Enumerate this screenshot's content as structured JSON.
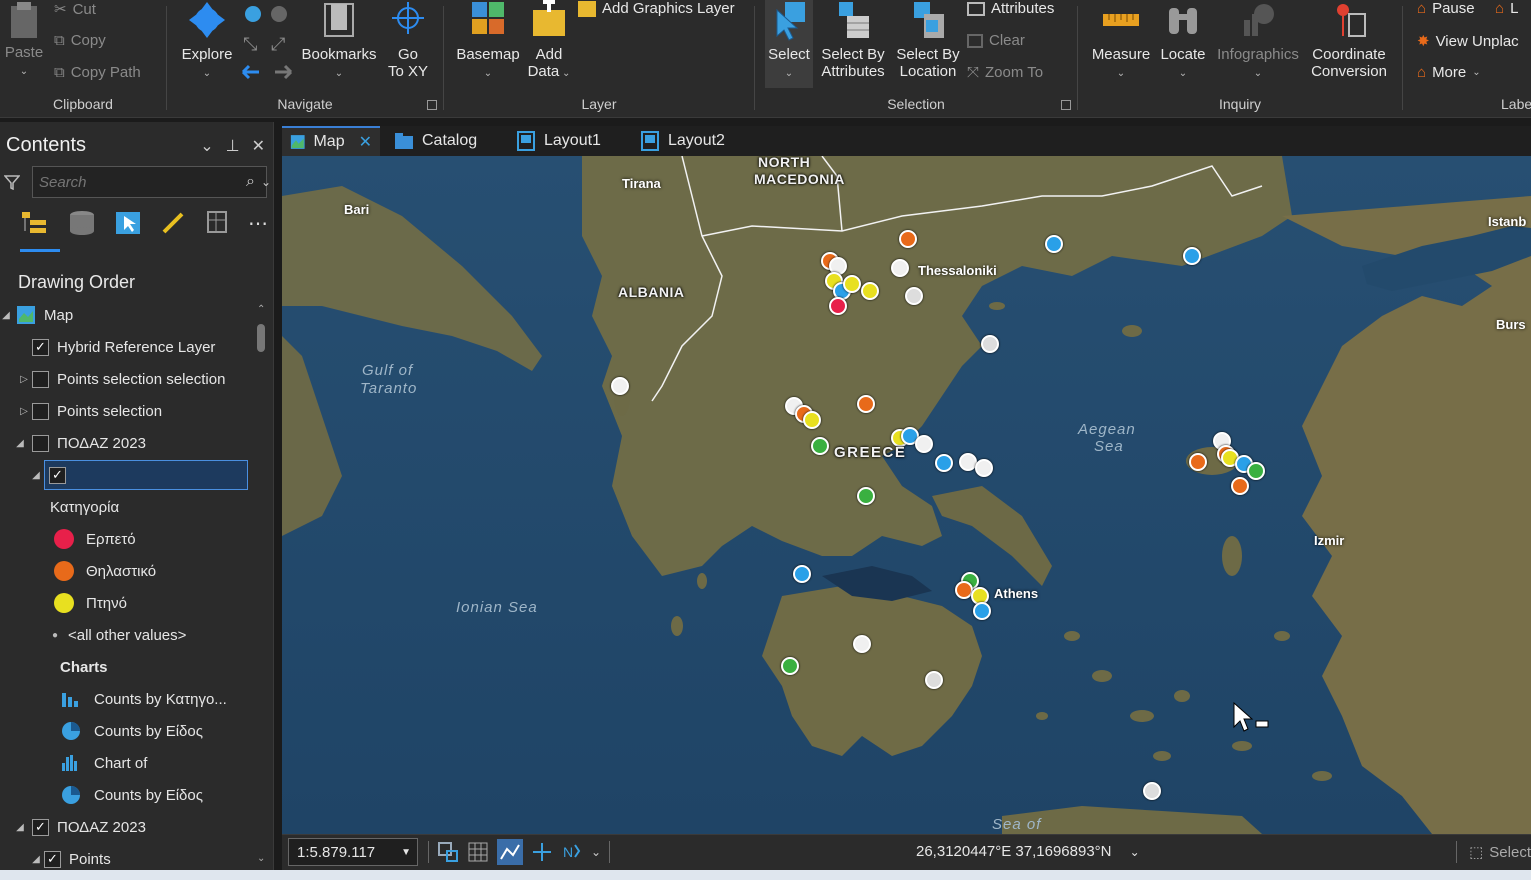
{
  "ribbon": {
    "clipboard": {
      "paste": "Paste",
      "cut": "Cut",
      "copy": "Copy",
      "copy_path": "Copy Path",
      "label": "Clipboard"
    },
    "navigate": {
      "explore": "Explore",
      "bookmarks": "Bookmarks",
      "go_to": "Go",
      "go_to_2": "To XY",
      "label": "Navigate"
    },
    "layer": {
      "basemap": "Basemap",
      "add_data": "Add",
      "add_data_2": "Data",
      "add_graphics": "Add Graphics Layer",
      "label": "Layer"
    },
    "selection": {
      "select": "Select",
      "sba": "Select By",
      "sba_2": "Attributes",
      "sbl": "Select By",
      "sbl_2": "Location",
      "attributes": "Attributes",
      "clear": "Clear",
      "zoom_to": "Zoom To",
      "label": "Selection"
    },
    "inquiry": {
      "measure": "Measure",
      "locate": "Locate",
      "infographics": "Infographics",
      "coord": "Coordinate",
      "coord_2": "Conversion",
      "label": "Inquiry"
    },
    "labeling": {
      "pause": "Pause",
      "l": "L",
      "view_unplaced": "View Unplac",
      "more": "More",
      "label": "Labelin"
    }
  },
  "contents": {
    "title": "Contents",
    "search_placeholder": "Search",
    "drawing_order": "Drawing Order",
    "rows": {
      "map": "Map",
      "hybrid": "Hybrid Reference Layer",
      "psel_sel": "Points selection selection",
      "psel": "Points selection",
      "podaz1": "ΠΟΔΑΖ 2023",
      "edit_value": "",
      "category": "Κατηγορία",
      "cat1": "Ερπετό",
      "cat2": "Θηλαστικό",
      "cat3": "Πτηνό",
      "other": "<all other values>",
      "charts": "Charts",
      "ch1": "Counts by Κατηγο...",
      "ch2": "Counts by Είδος",
      "ch3": "Chart of",
      "ch4": "Counts by Είδος",
      "podaz2": "ΠΟΔΑΖ 2023",
      "points": "Points"
    },
    "colors": {
      "cat1": "#e8204a",
      "cat2": "#e86a1a",
      "cat3": "#e8e020"
    }
  },
  "tabs": {
    "map": "Map",
    "catalog": "Catalog",
    "layout1": "Layout1",
    "layout2": "Layout2"
  },
  "map": {
    "labels": {
      "north_macedonia_1": "NORTH",
      "north_macedonia_2": "MACEDONIA",
      "albania": "ALBANIA",
      "greece": "GREECE",
      "tirana": "Tirana",
      "bari": "Bari",
      "thessaloniki": "Thessaloniki",
      "athens": "Athens",
      "izmir": "Izmir",
      "istanbul": "Istanb",
      "bursa": "Burs",
      "gulf1": "Gulf of",
      "gulf2": "Taranto",
      "ionian": "Ionian Sea",
      "aegean1": "Aegean",
      "aegean2": "Sea",
      "seaof": "Sea of"
    }
  },
  "status": {
    "scale": "1:5.879.117",
    "coords": "26,3120447°E 37,1696893°N",
    "select": "Select"
  }
}
